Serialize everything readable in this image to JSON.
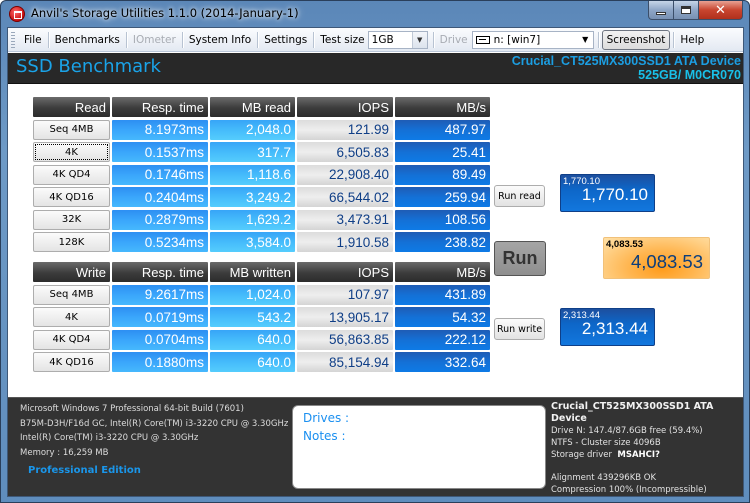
{
  "window": {
    "title": "Anvil's Storage Utilities 1.1.0 (2014-January-1)",
    "controls": {
      "minimize": "minimize",
      "maximize": "maximize",
      "close": "✕"
    }
  },
  "toolbar": {
    "file": "File",
    "benchmarks": "Benchmarks",
    "iometer": "IOmeter",
    "system_info": "System Info",
    "settings": "Settings",
    "test_size_label": "Test size",
    "test_size_value": "1GB",
    "drive_label": "Drive",
    "drive_value": "n: [win7]",
    "screenshot": "Screenshot",
    "help": "Help"
  },
  "header": {
    "title": "SSD Benchmark",
    "device_name": "Crucial_CT525MX300SSD1 ATA Device",
    "device_sub": "525GB/ M0CR070"
  },
  "read": {
    "headers": [
      "Read",
      "Resp. time",
      "MB read",
      "IOPS",
      "MB/s"
    ],
    "rows": [
      {
        "test": "Seq 4MB",
        "resp": "8.1973ms",
        "mb": "2,048.0",
        "iops": "121.99",
        "mbs": "487.97"
      },
      {
        "test": "4K",
        "resp": "0.1537ms",
        "mb": "317.7",
        "iops": "6,505.83",
        "mbs": "25.41"
      },
      {
        "test": "4K QD4",
        "resp": "0.1746ms",
        "mb": "1,118.6",
        "iops": "22,908.40",
        "mbs": "89.49"
      },
      {
        "test": "4K QD16",
        "resp": "0.2404ms",
        "mb": "3,249.2",
        "iops": "66,544.02",
        "mbs": "259.94"
      },
      {
        "test": "32K",
        "resp": "0.2879ms",
        "mb": "1,629.2",
        "iops": "3,473.91",
        "mbs": "108.56"
      },
      {
        "test": "128K",
        "resp": "0.5234ms",
        "mb": "3,584.0",
        "iops": "1,910.58",
        "mbs": "238.82"
      }
    ]
  },
  "write": {
    "headers": [
      "Write",
      "Resp. time",
      "MB written",
      "IOPS",
      "MB/s"
    ],
    "rows": [
      {
        "test": "Seq 4MB",
        "resp": "9.2617ms",
        "mb": "1,024.0",
        "iops": "107.97",
        "mbs": "431.89"
      },
      {
        "test": "4K",
        "resp": "0.0719ms",
        "mb": "543.2",
        "iops": "13,905.17",
        "mbs": "54.32"
      },
      {
        "test": "4K QD4",
        "resp": "0.0704ms",
        "mb": "640.0",
        "iops": "56,863.85",
        "mbs": "222.12"
      },
      {
        "test": "4K QD16",
        "resp": "0.1880ms",
        "mb": "640.0",
        "iops": "85,154.94",
        "mbs": "332.64"
      }
    ]
  },
  "controls": {
    "run_read": "Run read",
    "run": "Run",
    "run_write": "Run write"
  },
  "scores": {
    "read": {
      "small": "1,770.10",
      "big": "1,770.10"
    },
    "total": {
      "small": "4,083.53",
      "big": "4,083.53"
    },
    "write": {
      "small": "2,313.44",
      "big": "2,313.44"
    }
  },
  "footer": {
    "os": "Microsoft Windows 7 Professional  64-bit Build (7601)",
    "board": "B75M-D3H/F16d GC, Intel(R) Core(TM) i3-3220 CPU @ 3.30GHz",
    "cpu": "Intel(R) Core(TM) i3-3220 CPU @ 3.30GHz",
    "memory": "Memory : 16,259 MB",
    "edition": "Professional Edition",
    "drives_label": "Drives :",
    "notes_label": "Notes :",
    "drive_title": "Crucial_CT525MX300SSD1 ATA Device",
    "drive_free": "Drive N: 147.4/87.6GB free (59.4%)",
    "fs": "NTFS - Cluster size 4096B",
    "driver_label": "Storage driver",
    "driver_value": "MSAHCI?",
    "alignment": "Alignment 439296KB OK",
    "compression": "Compression 100% (Incompressible)"
  },
  "colors": {
    "accent_blue": "#1aa3e8",
    "resp_cell": "#3aa6fb",
    "mbs_cell": "#1470d6",
    "total_score": "#ffb54f"
  }
}
